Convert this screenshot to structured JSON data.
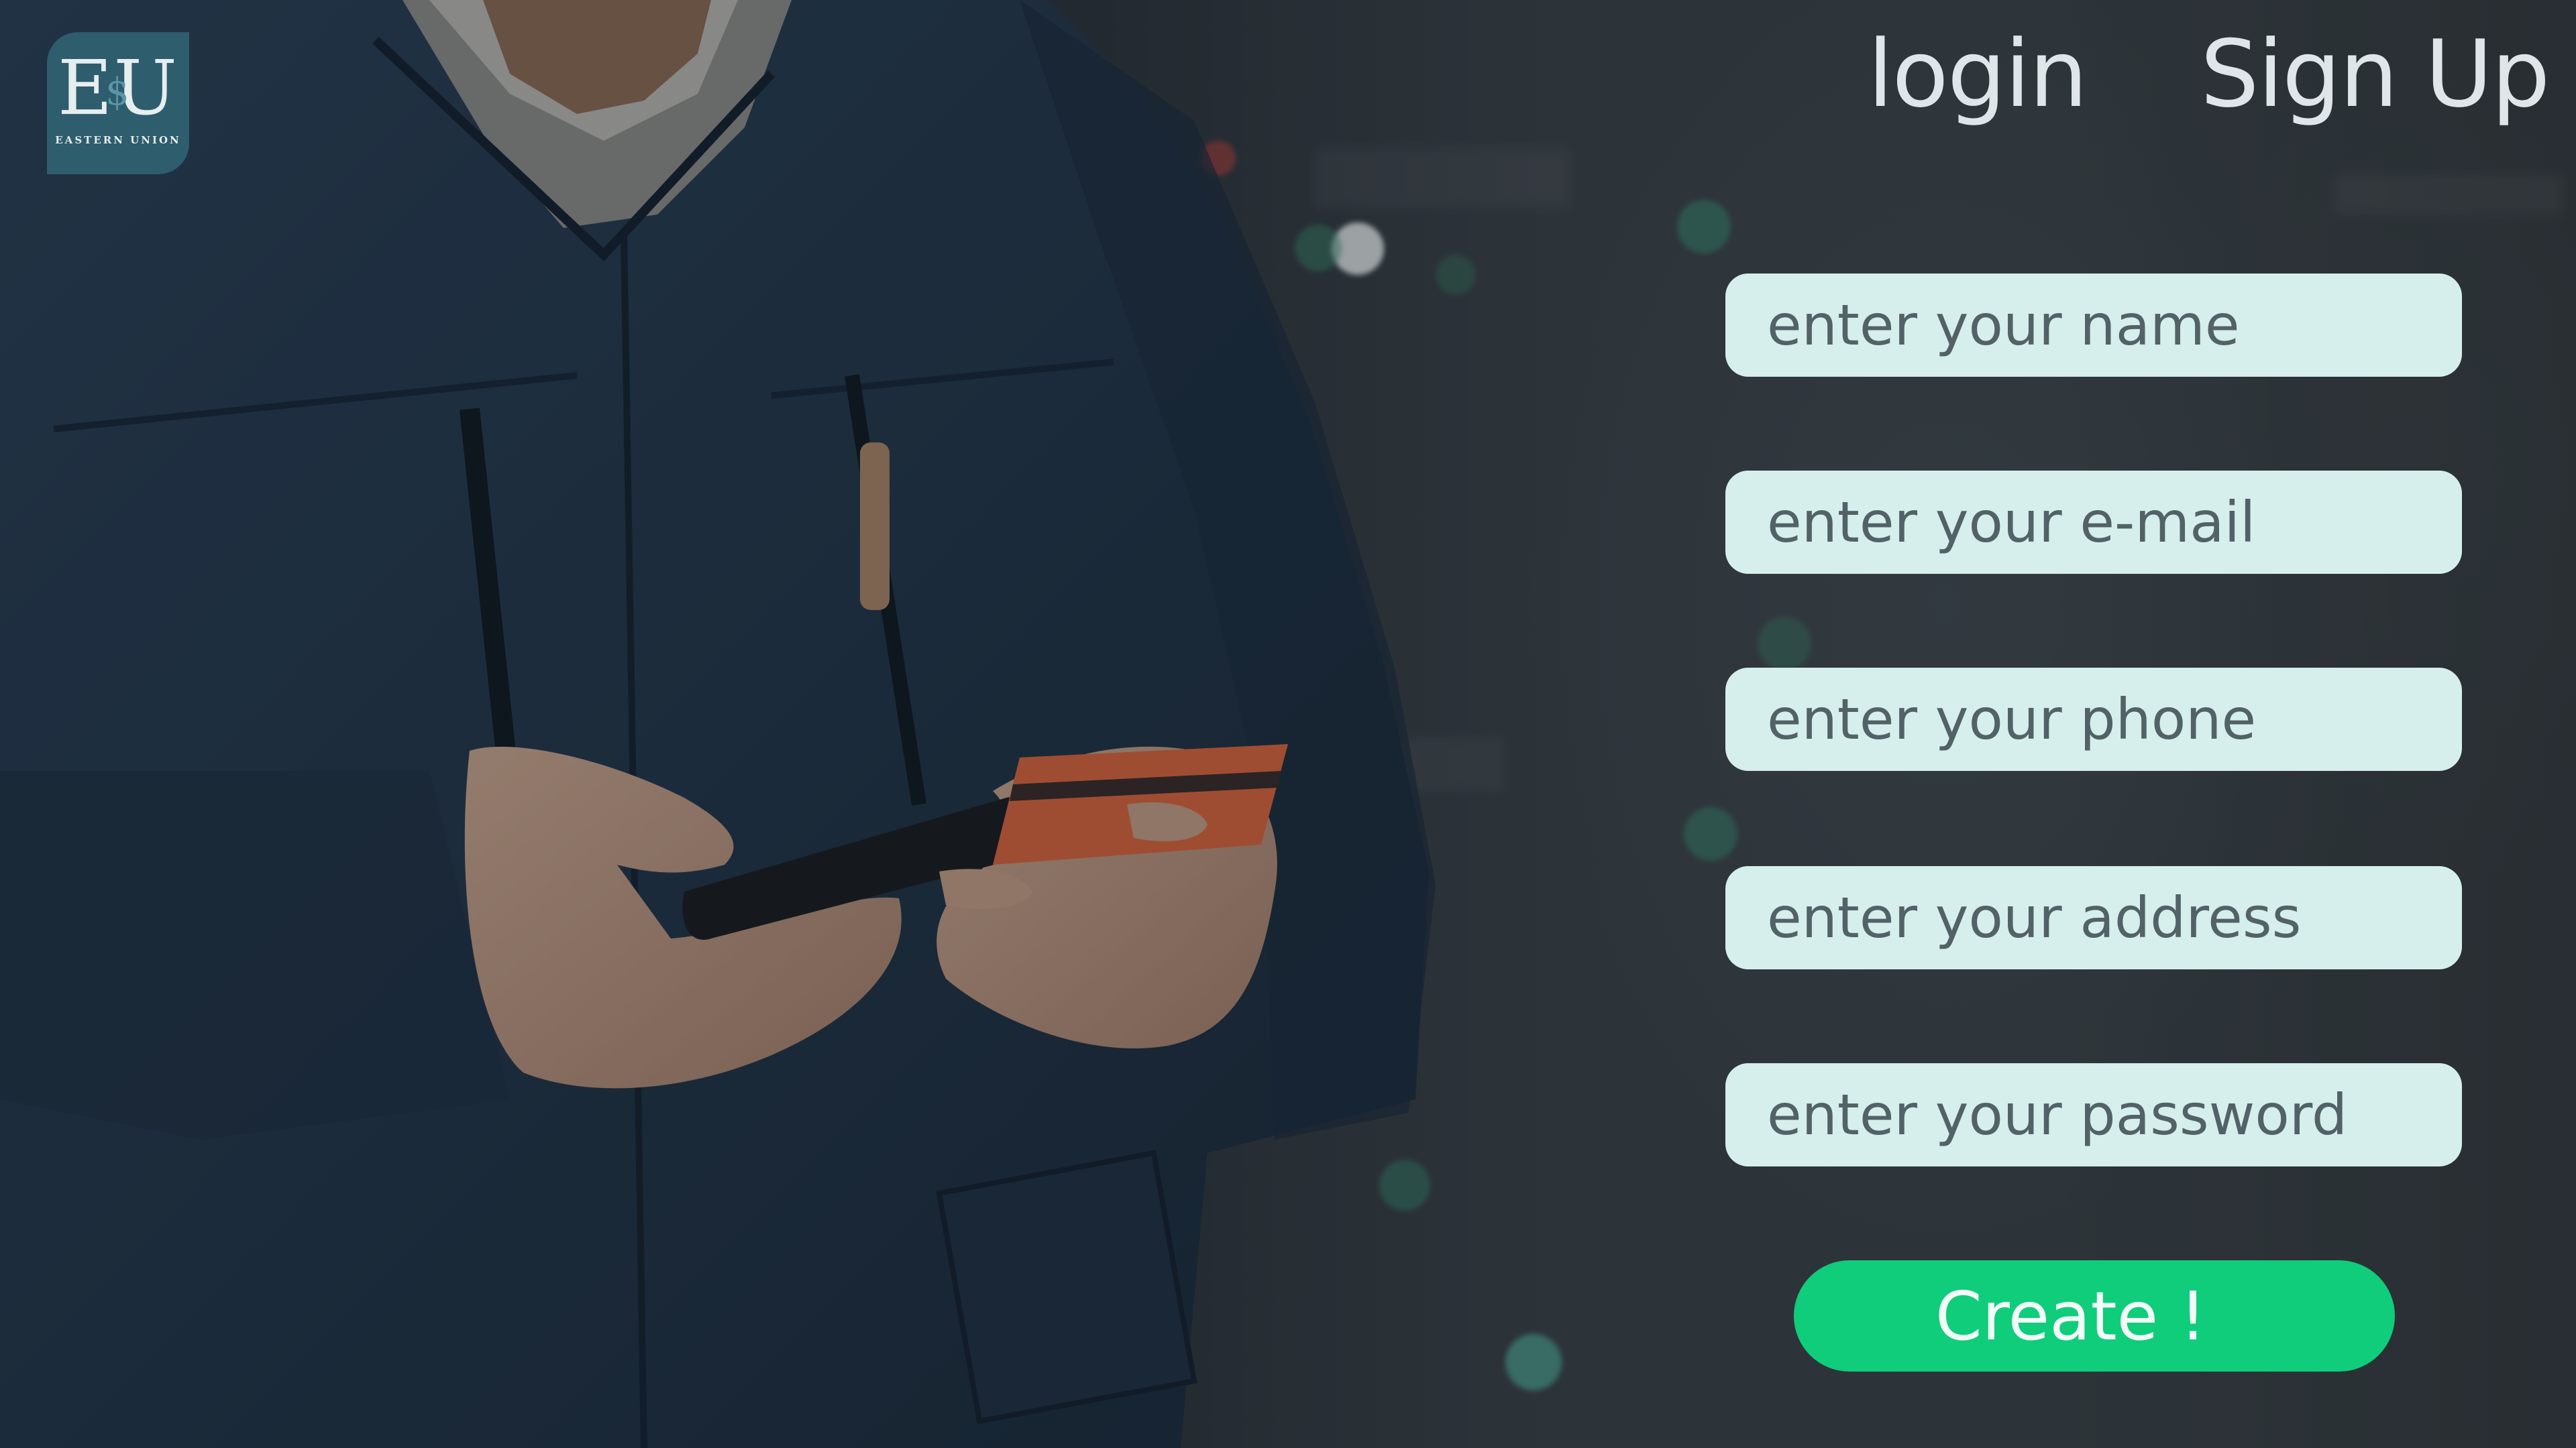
{
  "brand": {
    "logo_text": "EU",
    "logo_subtext": "EASTERN UNION"
  },
  "nav": {
    "login_label": "login",
    "signup_label": "Sign Up"
  },
  "form": {
    "name_placeholder": "enter your name",
    "email_placeholder": "enter your e-mail",
    "phone_placeholder": "enter your phone",
    "address_placeholder": "enter your address",
    "password_placeholder": "enter your password",
    "submit_label": "Create !"
  },
  "colors": {
    "logo_bg": "#2e5d6d",
    "field_bg": "#d6efed",
    "button_bg": "#0fcd7b",
    "nav_text": "#dfe5e8"
  },
  "icons": {
    "logo": "eastern-union-logo"
  }
}
